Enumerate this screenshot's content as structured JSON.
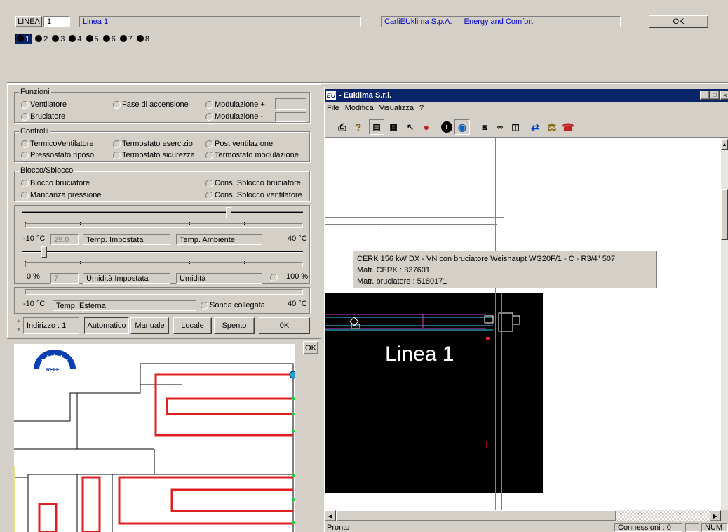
{
  "header": {
    "line_button": "LINEA",
    "line_number": "1",
    "line_name": "Linea 1",
    "company": "CarliEUklima S.p.A.",
    "slogan": "Energy and Comfort",
    "ok": "OK"
  },
  "lines": [
    "1",
    "2",
    "3",
    "4",
    "5",
    "6",
    "7",
    "8"
  ],
  "funzioni": {
    "title": "Funzioni",
    "ventilatore": "Ventilatore",
    "bruciatore": "Bruciatore",
    "fase": "Fase di accensione",
    "mod_plus": "Modulazione +",
    "mod_minus": "Modulazione -"
  },
  "controlli": {
    "title": "Controlli",
    "termico": "TermicoVentilatore",
    "pressostato": "Pressostato riposo",
    "term_esercizio": "Termostato esercizio",
    "term_sicurezza": "Termostato sicurezza",
    "post_vent": "Post ventilazione",
    "term_mod": "Termostato modulazione"
  },
  "blocco": {
    "title": "Blocco/Sblocco",
    "blocco_bruc": "Blocco bruciatore",
    "mancanza": "Mancanza pressione",
    "cons_bruc": "Cons. Sblocco bruciatore",
    "cons_vent": "Cons. Sblocco ventilatore"
  },
  "temp": {
    "min": "-10 °C",
    "value": "29.0",
    "impostata": "Temp. Impostata",
    "ambiente": "Temp. Ambiente",
    "max": "40 °C",
    "slider_level": 0.74
  },
  "umid": {
    "min": "0 %",
    "value": "7",
    "impostata": "Umidità Impostata",
    "label": "Umidità",
    "max": "100 %",
    "slider_level": 0.07
  },
  "esterna": {
    "min": "-10 °C",
    "label": "Temp. Esterna",
    "sonda": "Sonda collegata",
    "max": "40 °C"
  },
  "bottom_bar": {
    "indirizzo": "Indirizzo : 1",
    "automatico": "Automatico",
    "manuale": "Manuale",
    "locale": "Locale",
    "spento": "Spento",
    "ok": "0K"
  },
  "map": {
    "ok": "OK",
    "logo_text": "REFEL"
  },
  "euklima": {
    "title": "- Euklima S.r.l.",
    "menu": [
      "File",
      "Modifica",
      "Visualizza",
      "?"
    ],
    "tooltip_line1": "CERK 156 kW DX - VN con bruciatore Weishaupt WG20F/1 - C - R3/4\" 507",
    "tooltip_line2": "Matr. CERK : 337601",
    "tooltip_line3": "Matr. bruciatore : 5180171",
    "canvas_label": "Linea 1",
    "status": "Pronto",
    "connessioni": "Connessioni : 0",
    "num": "NUM"
  },
  "colors": {
    "selection": "#0a246a",
    "title_bar": "#0a246a",
    "duct": "#e02020",
    "link_text": "#0000cc"
  }
}
